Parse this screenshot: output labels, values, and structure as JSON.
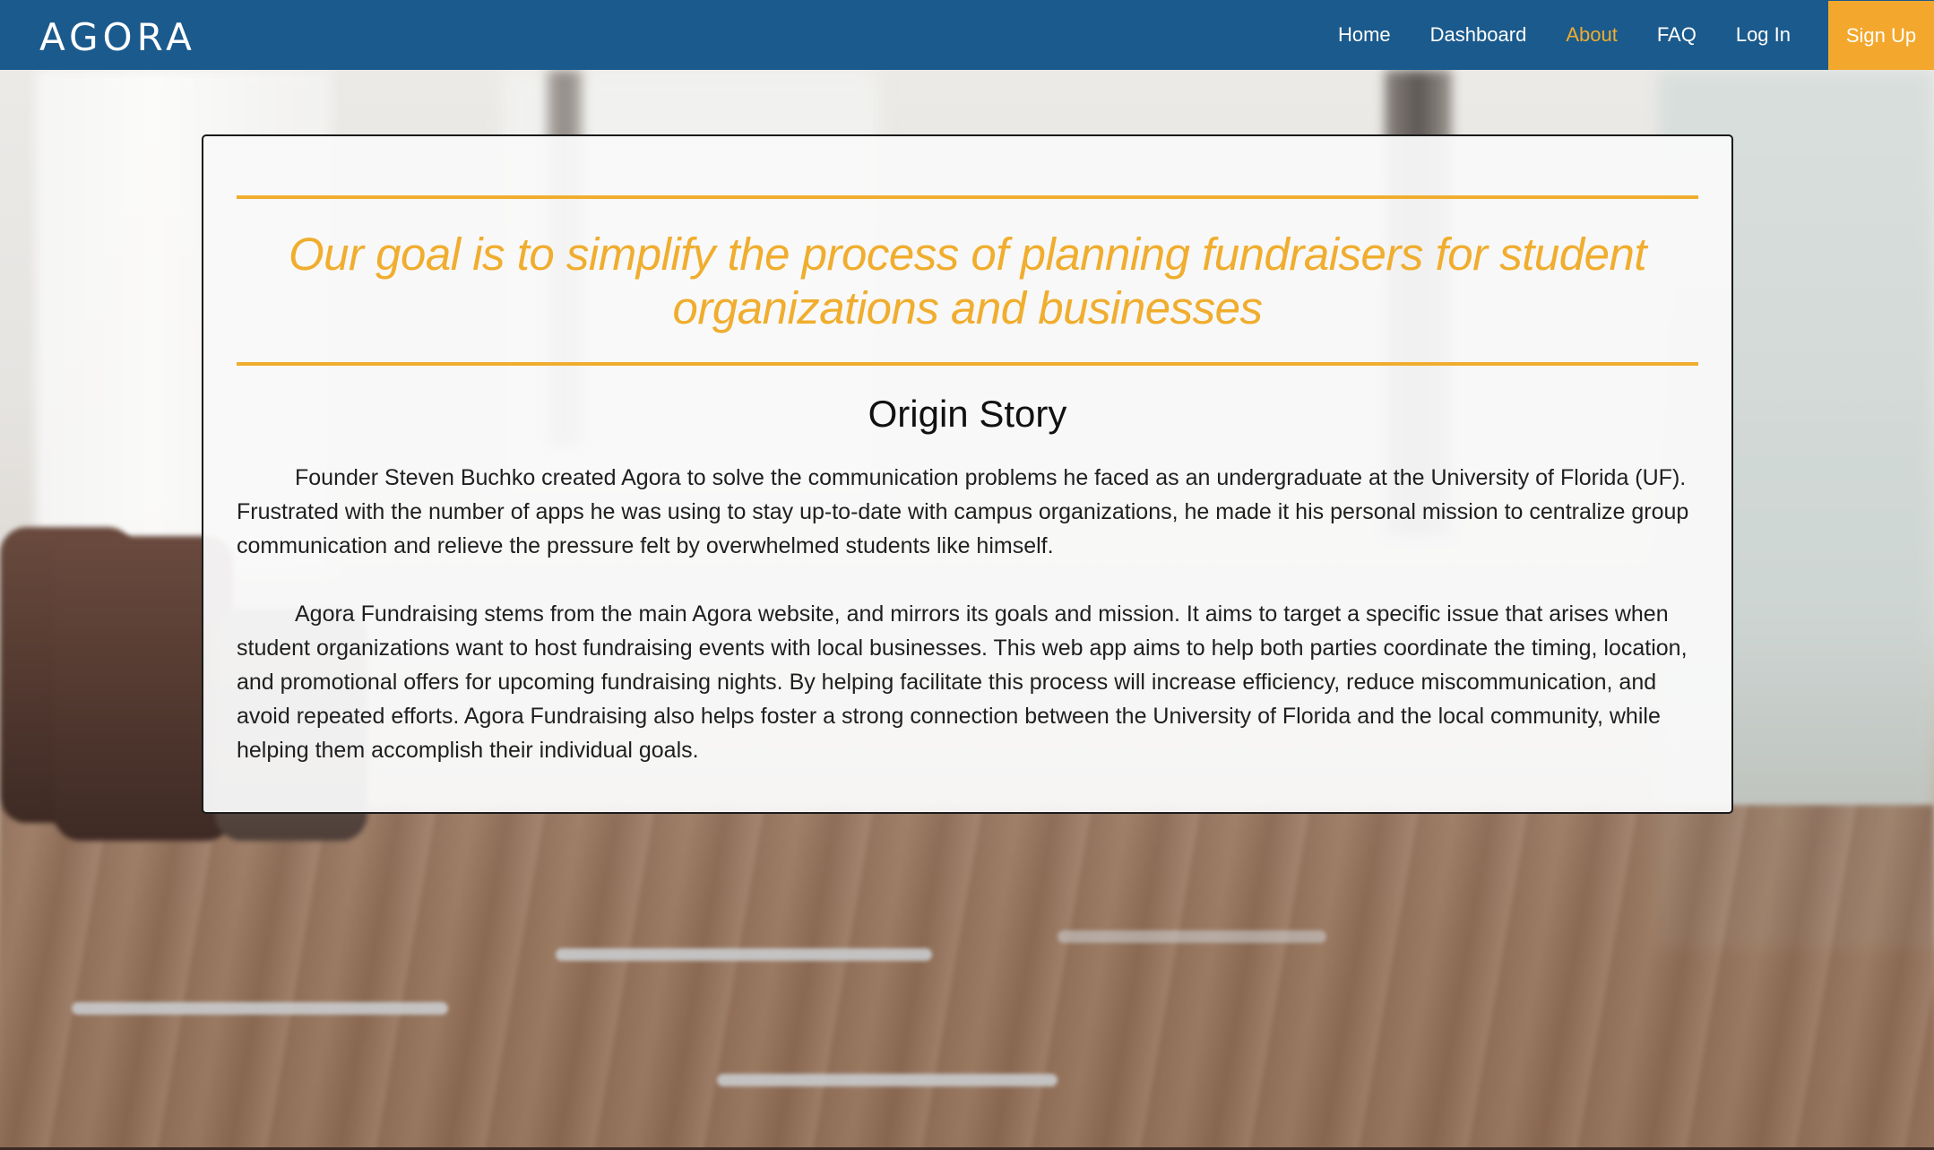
{
  "brand": {
    "logo_text": "AGORA"
  },
  "nav": {
    "items": [
      {
        "label": "Home"
      },
      {
        "label": "Dashboard"
      },
      {
        "label": "About"
      },
      {
        "label": "FAQ"
      },
      {
        "label": "Log In"
      }
    ],
    "active": "About",
    "signup_label": "Sign Up"
  },
  "about": {
    "mission": "Our goal is to simplify the process of planning fundraisers for student organizations and businesses",
    "section_title": "Origin Story",
    "paragraphs": [
      "Founder Steven Buchko created Agora to solve the communication problems he faced as an undergraduate at the University of Florida (UF). Frustrated with the number of apps he was using to stay up-to-date with campus organizations, he made it his personal mission to centralize group communication and relieve the pressure felt by overwhelmed students like himself.",
      "Agora Fundraising stems from the main Agora website, and mirrors its goals and mission. It aims to target a specific issue that arises when student organizations want to host fundraising events with local businesses. This web app aims to help both parties coordinate the timing, location, and promotional offers for upcoming fundraising nights. By helping facilitate this process will increase efficiency, reduce miscommunication, and avoid repeated efforts. Agora Fundraising also helps foster a strong connection between the University of Florida and the local community, while helping them accomplish their individual goals."
    ]
  },
  "colors": {
    "navbar": "#1b5a8d",
    "accent": "#f0ad2e",
    "signup": "#f3a82d",
    "card_border": "#1a1a1a"
  },
  "background": {
    "icon": "conference-room-photo"
  }
}
